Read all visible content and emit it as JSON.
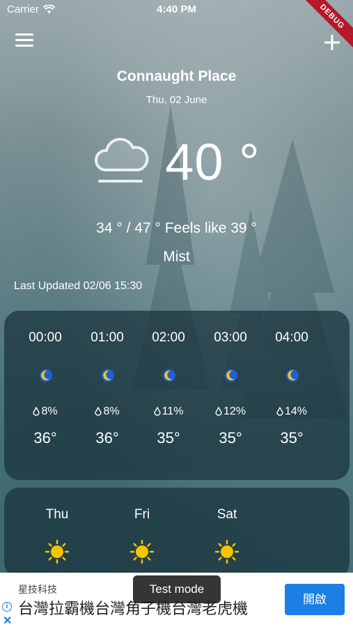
{
  "status_bar": {
    "carrier": "Carrier",
    "time": "4:40 PM"
  },
  "debug_label": "DEBUG",
  "header": {
    "city": "Connaught Place",
    "date": "Thu, 02 June"
  },
  "current": {
    "temperature": "40 °",
    "range_feels": "34 ° / 47 ° Feels like 39 °",
    "condition": "Mist",
    "last_updated": "Last Updated 02/06 15:30",
    "icon": "mist-icon"
  },
  "hourly": [
    {
      "time": "00:00",
      "icon": "moon-icon",
      "pop": "8%",
      "temp": "36°"
    },
    {
      "time": "01:00",
      "icon": "moon-icon",
      "pop": "8%",
      "temp": "36°"
    },
    {
      "time": "02:00",
      "icon": "moon-icon",
      "pop": "11%",
      "temp": "35°"
    },
    {
      "time": "03:00",
      "icon": "moon-icon",
      "pop": "12%",
      "temp": "35°"
    },
    {
      "time": "04:00",
      "icon": "moon-icon",
      "pop": "14%",
      "temp": "35°"
    }
  ],
  "daily": [
    {
      "day": "Thu",
      "icon": "sun-icon"
    },
    {
      "day": "Fri",
      "icon": "sun-icon"
    },
    {
      "day": "Sat",
      "icon": "sun-icon"
    }
  ],
  "ad": {
    "brand": "星技科技",
    "title": "台灣拉霸機台灣角子機台灣老虎機",
    "button": "開啟"
  },
  "toast": "Test mode",
  "colors": {
    "accent": "#1b7fe3",
    "moon": "#f5c518",
    "sun": "#f7c400",
    "panel": "#19323a"
  }
}
